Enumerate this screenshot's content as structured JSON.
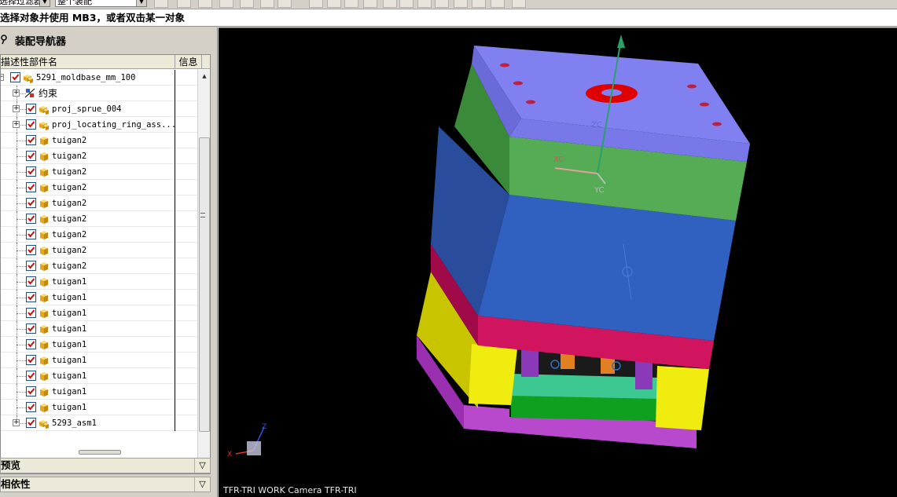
{
  "toolbar": {
    "filter_combo": "选择过滤器",
    "scope_combo": "整个装配"
  },
  "status": {
    "prompt": "选择对象并使用 MB3，或者双击某一对象"
  },
  "navigator": {
    "title": "装配导航器",
    "columns": {
      "name": "描述性部件名",
      "info": "信息"
    },
    "rows": [
      {
        "label": "5291_moldbase_mm_100",
        "level": 0,
        "expander": "⊟",
        "icon": "assembly"
      },
      {
        "label": "约束",
        "level": 1,
        "expander": "+",
        "icon": "constraint"
      },
      {
        "label": "proj_sprue_004",
        "level": 1,
        "expander": "+",
        "icon": "assembly"
      },
      {
        "label": "proj_locating_ring_ass...",
        "level": 1,
        "expander": "+",
        "icon": "assembly"
      },
      {
        "label": "tuigan2",
        "level": 1,
        "icon": "part"
      },
      {
        "label": "tuigan2",
        "level": 1,
        "icon": "part"
      },
      {
        "label": "tuigan2",
        "level": 1,
        "icon": "part"
      },
      {
        "label": "tuigan2",
        "level": 1,
        "icon": "part"
      },
      {
        "label": "tuigan2",
        "level": 1,
        "icon": "part"
      },
      {
        "label": "tuigan2",
        "level": 1,
        "icon": "part"
      },
      {
        "label": "tuigan2",
        "level": 1,
        "icon": "part"
      },
      {
        "label": "tuigan2",
        "level": 1,
        "icon": "part"
      },
      {
        "label": "tuigan2",
        "level": 1,
        "icon": "part"
      },
      {
        "label": "tuigan1",
        "level": 1,
        "icon": "part"
      },
      {
        "label": "tuigan1",
        "level": 1,
        "icon": "part"
      },
      {
        "label": "tuigan1",
        "level": 1,
        "icon": "part"
      },
      {
        "label": "tuigan1",
        "level": 1,
        "icon": "part"
      },
      {
        "label": "tuigan1",
        "level": 1,
        "icon": "part"
      },
      {
        "label": "tuigan1",
        "level": 1,
        "icon": "part"
      },
      {
        "label": "tuigan1",
        "level": 1,
        "icon": "part"
      },
      {
        "label": "tuigan1",
        "level": 1,
        "icon": "part"
      },
      {
        "label": "tuigan1",
        "level": 1,
        "icon": "part"
      },
      {
        "label": "5293_asm1",
        "level": 1,
        "expander": "+",
        "icon": "assembly"
      }
    ],
    "sections": {
      "preview": "预览",
      "dependency": "相依性"
    }
  },
  "viewport": {
    "camera_label": "TFR-TRI WORK Camera TFR-TRI",
    "wcs_labels": {
      "zc": "ZC",
      "xc": "XC",
      "yc": "YC"
    },
    "triad_labels": {
      "z": "Z",
      "x": "X"
    },
    "colors": {
      "background": "#000000",
      "top_plate": "#8080f0",
      "upper_plate": "#55a855",
      "cavity_plate": "#3055b0",
      "core_plate": "#c0105a",
      "spacer_block": "#e0dc00",
      "bottom_plate": "#b040c8",
      "locating_ring": "#e00000"
    }
  }
}
